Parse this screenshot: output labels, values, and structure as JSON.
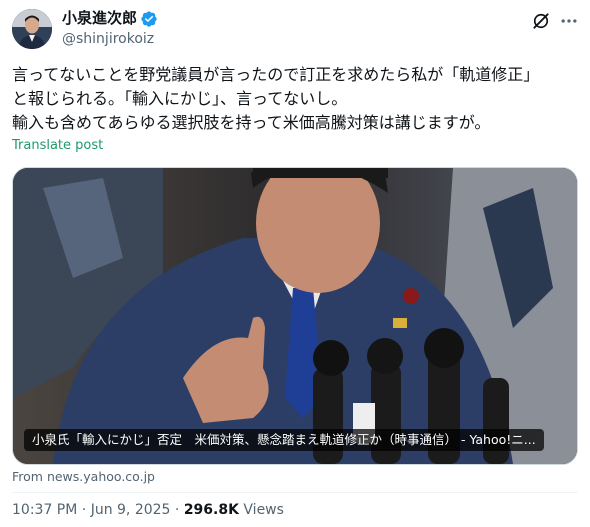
{
  "author": {
    "display_name": "小泉進次郎",
    "handle": "@shinjirokoiz",
    "verified_icon": "verified-badge-icon"
  },
  "header_actions": {
    "grok_icon": "grok-icon",
    "more_icon": "more-dots-icon"
  },
  "tweet": {
    "lines": [
      "言ってないことを野党議員が言ったので訂正を求めたら私が「軌道修正」",
      "と報じられる。「輸入にかじ」、言ってないし。",
      "輸入も含めてあらゆる選択肢を持って米価高騰対策は講じますが。"
    ],
    "translate_label": "Translate post"
  },
  "card": {
    "caption": "小泉氏「輸入にかじ」否定　米価対策、懸念踏まえ軌道修正か（時事通信） - Yahoo!ニ...",
    "source": "From news.yahoo.co.jp"
  },
  "meta": {
    "time": "10:37 PM",
    "separator": "·",
    "date": "Jun 9, 2025",
    "views_count": "296.8K",
    "views_label": "Views"
  },
  "colors": {
    "text_primary": "#0f1419",
    "text_secondary": "#536471",
    "translate_link": "#1d9b6a",
    "verified_blue": "#1d9bf0"
  }
}
